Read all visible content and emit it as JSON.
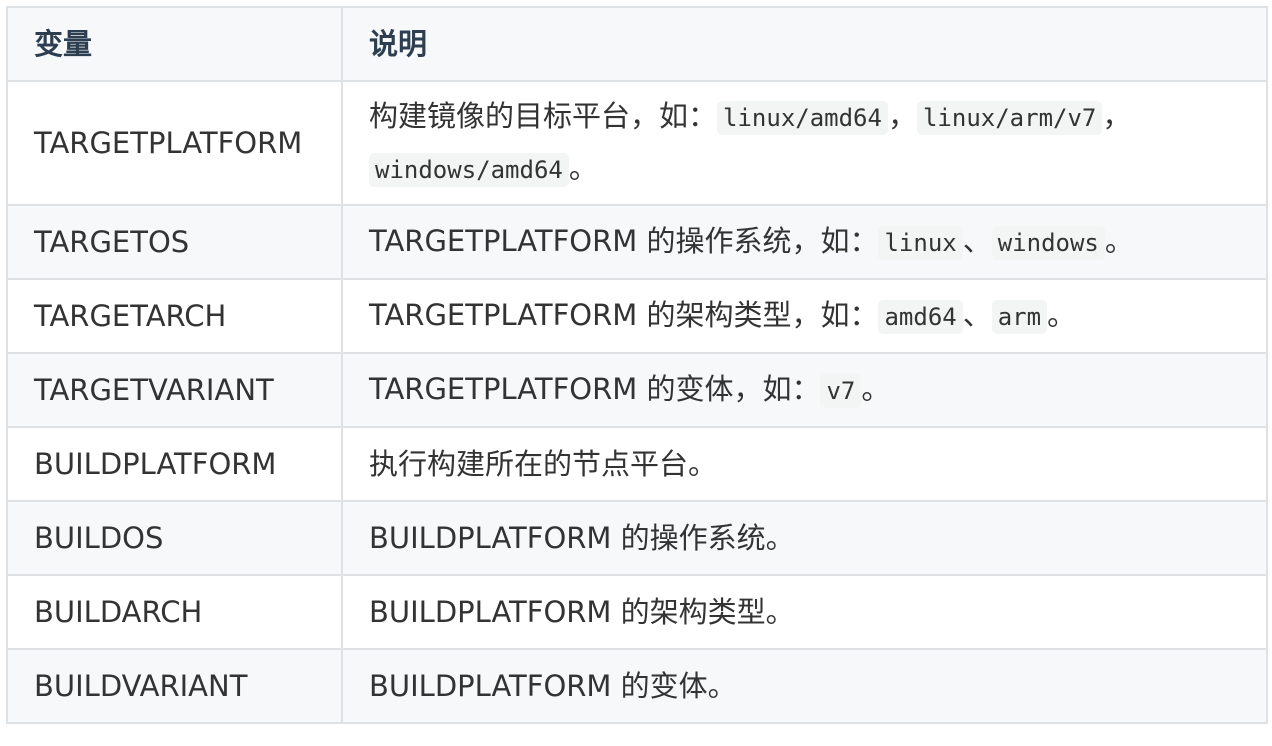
{
  "header": {
    "col1": "变量",
    "col2": "说明"
  },
  "rows": [
    {
      "name": "TARGETPLATFORM",
      "desc_pre": "构建镜像的目标平台，如：",
      "codes": [
        "linux/amd64",
        "linux/arm/v7",
        "windows/amd64"
      ],
      "sep1": "，",
      "sep2": "，",
      "desc_end": "。"
    },
    {
      "name": "TARGETOS",
      "desc_pre": "TARGETPLATFORM 的操作系统，如：",
      "codes": [
        "linux",
        "windows"
      ],
      "sep1": "、",
      "desc_end": "。"
    },
    {
      "name": "TARGETARCH",
      "desc_pre": "TARGETPLATFORM 的架构类型，如：",
      "codes": [
        "amd64",
        "arm"
      ],
      "sep1": "、",
      "desc_end": "。"
    },
    {
      "name": "TARGETVARIANT",
      "desc_pre": "TARGETPLATFORM 的变体，如：",
      "codes": [
        "v7"
      ],
      "desc_end": "。"
    },
    {
      "name": "BUILDPLATFORM",
      "desc": "执行构建所在的节点平台。"
    },
    {
      "name": "BUILDOS",
      "desc": "BUILDPLATFORM 的操作系统。"
    },
    {
      "name": "BUILDARCH",
      "desc": "BUILDPLATFORM 的架构类型。"
    },
    {
      "name": "BUILDVARIANT",
      "desc": "BUILDPLATFORM 的变体。"
    }
  ]
}
